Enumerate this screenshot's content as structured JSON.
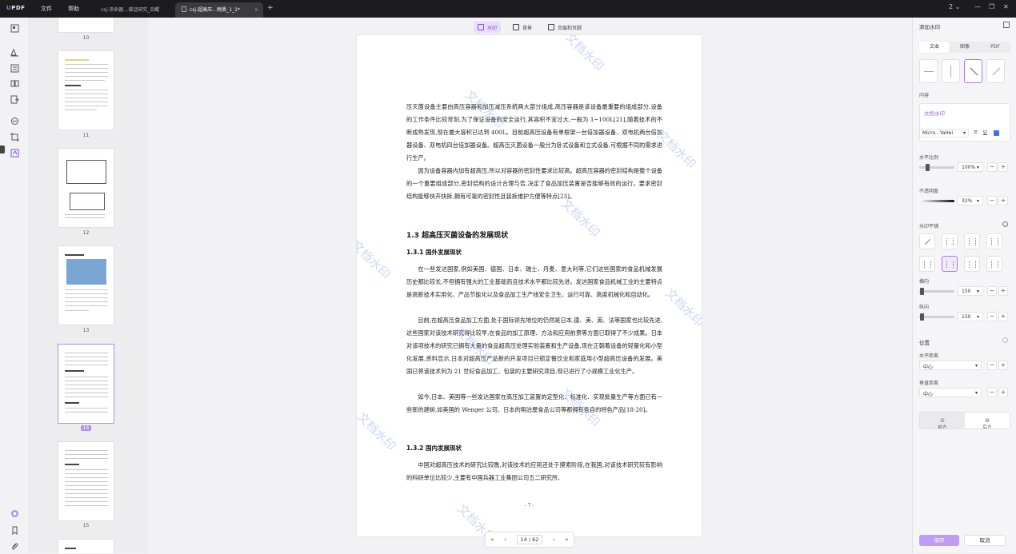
{
  "app": {
    "logo": "UPDF",
    "menu_file": "文件",
    "menu_help": "帮助"
  },
  "tabs": [
    {
      "label": "csj-浓命器…谱话研究_吕鲲"
    },
    {
      "label": "csj-超高压…物质_1_1*",
      "close": "×"
    }
  ],
  "window": {
    "count": "2",
    "chevron": "⌄",
    "minimize": "—",
    "maximize": "❐",
    "close": "✕"
  },
  "toolbar": {
    "watermark": "水印",
    "background": "背景",
    "header_footer": "页眉和页脚"
  },
  "thumbnails": [
    {
      "num": "10"
    },
    {
      "num": "11"
    },
    {
      "num": "12"
    },
    {
      "num": "13"
    },
    {
      "num": "14",
      "selected": true
    },
    {
      "num": "15"
    }
  ],
  "document": {
    "p1": "压灭菌设备主要由高压容器和加压减压系统两大部分组成,高压容器是该设备最重要的组成部分,设备的工作条件比较苛刻,为了保证设备的安全运行,其容积不宜过大,一般为 1~100L[21],随着技术的不断成熟发现,现在最大容积已达到 400L。目前超高压设备有单框架一台倍加器设备、双电机两台倍加器设备、双电机四台倍加器设备。超高压灭菌设备一般分为卧式设备和立式设备,可根据不同的需求进行生产。",
    "p2": "因为设备容器内加有超高压,所以对容器的密封性要求比较高。超高压容器的密封结构是整个设备的一个重要组成部分,密封结构的设计合理与否,决定了食品加压装置是否能够有效的运行。要求密封结构能够快开快拆,拥有可靠的密封性且装拆维护方便等特点[23]。",
    "h_13": "1.3 超高压灭菌设备的发展现状",
    "h_131": "1.3.1  国外发展现状",
    "p3": "在一些发达国家,例如美国、德国、日本、瑞士、丹麦、意大利等,它们这些国家的食品机械发展历史都比较长,不但拥有强大的工业基础而且技术水平都比较先进。发达国家食品机械工业的主要特点是高新技术实用化、产品节能化以及食品加工生产线安全卫生、运行可靠、高度机械化和自动化。",
    "p4": "目前,在超高压食品加工方面,处于国际领先地位的仍然是日本,德、美、英、法等国家也比较先进,这些国家对该技术研究得比较早,在食品的加工原理、方法和应用前景等方面已取得了不少成果。日本对该项技术的研究已拥有大量的食品超高压处理实验装置和生产设备,现在正朝着设备的轻量化和小型化发展,资料显示,日本对超高压产品新的开发项目已锁定餐饮业和家庭用小型超高压设备的发展。美国已将该技术列为 21 世纪食品加工、包装的主要研究项目,现已进行了小规模工业化生产。",
    "p5": "如今,日本、美国等一些发达国家在高压加工装置的定型化、标准化、实现批量生产等方面已有一些新的建树,如美国的 Wenger 公司、日本的明治屋食品公司等都拥有各自的特色产品[18-20]。",
    "h_132": "1.3.2  国内发展现状",
    "p6": "中国对超高压技术的研究比较晚,对该技术的应用还处于摸索阶段,在我国,对该技术研究较有影响的科研单位比较少,主要有中国兵器工业集团公司五二研究所、",
    "page_number": "- 7 -",
    "watermark_text": "文档水印"
  },
  "pager": {
    "current": "14",
    "sep": "/",
    "total": "62"
  },
  "panel": {
    "title": "添加水印",
    "tab_text": "文本",
    "tab_image": "图像",
    "tab_pdf": "PDF",
    "content_label": "内容",
    "content_value": "文档水印",
    "font": "Micro...YaHei",
    "scale_label": "水平比例",
    "scale_value": "100%",
    "opacity_label": "不透明度",
    "opacity_value": "32%",
    "tile_label": "水印平铺",
    "h_spacing_label": "横向",
    "h_spacing_value": "150",
    "v_spacing_label": "纵向",
    "v_spacing_value": "150",
    "position_label": "位置",
    "h_align_label": "水平距离",
    "h_align_value": "中心",
    "v_align_label": "垂直距离",
    "v_align_value": "中心",
    "front_label": "前方",
    "back_label": "后方",
    "save_label": "保存",
    "cancel_label": "取消"
  },
  "colors": {
    "accent": "#a87af0",
    "titlebar": "#1c1c1f",
    "watermark": "#82a0e6"
  }
}
